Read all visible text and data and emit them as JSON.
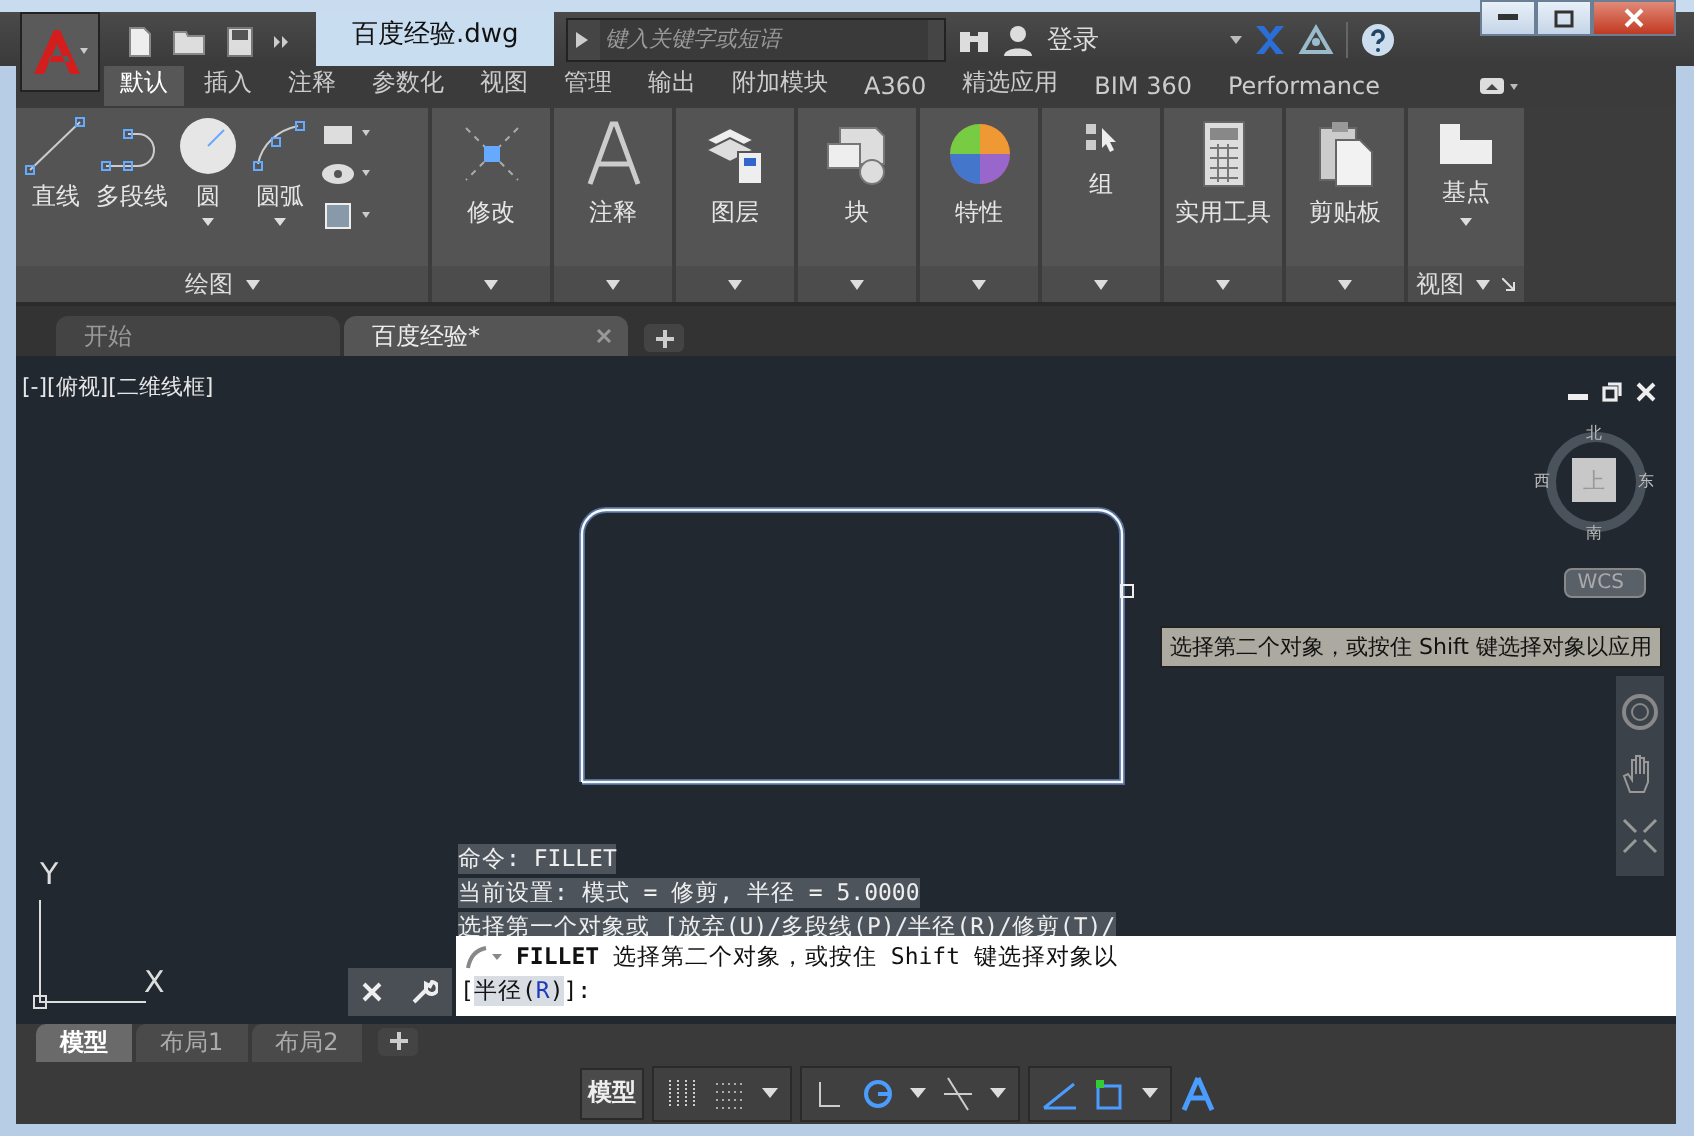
{
  "title_bar": {
    "title": "百度经验.dwg",
    "search": {
      "placeholder": "键入关键字或短语"
    },
    "sign_in": "登录"
  },
  "ribbon_tabs": [
    {
      "label": "默认",
      "selected": true
    },
    {
      "label": "插入",
      "selected": false
    },
    {
      "label": "注释",
      "selected": false
    },
    {
      "label": "参数化",
      "selected": false
    },
    {
      "label": "视图",
      "selected": false
    },
    {
      "label": "管理",
      "selected": false
    },
    {
      "label": "输出",
      "selected": false
    },
    {
      "label": "附加模块",
      "selected": false
    },
    {
      "label": "A360",
      "selected": false
    },
    {
      "label": "精选应用",
      "selected": false
    },
    {
      "label": "BIM 360",
      "selected": false
    },
    {
      "label": "Performance",
      "selected": false
    }
  ],
  "ribbon_panels": [
    {
      "kind": "draw",
      "tools": [
        "直线",
        "多段线",
        "圆",
        "圆弧"
      ],
      "footer": "绘图"
    },
    {
      "kind": "tool",
      "label": "修改"
    },
    {
      "kind": "tool",
      "label": "注释"
    },
    {
      "kind": "tool",
      "label": "图层"
    },
    {
      "kind": "tool",
      "label": "块"
    },
    {
      "kind": "tool",
      "label": "特性"
    },
    {
      "kind": "tool",
      "label": "组"
    },
    {
      "kind": "tool",
      "label": "实用工具"
    },
    {
      "kind": "tool",
      "label": "剪贴板"
    },
    {
      "kind": "view",
      "label": "基点",
      "footer": "视图"
    }
  ],
  "file_tabs": [
    {
      "label": "开始",
      "selected": false
    },
    {
      "label": "百度经验*",
      "selected": true
    }
  ],
  "viewport": {
    "label": "[-][俯视][二维线框]",
    "viewcube": {
      "north": "北",
      "south": "南",
      "east": "东",
      "west": "西",
      "face": "上",
      "ucs": "WCS"
    },
    "tooltip": "选择第二个对象，或按住 Shift 键选择对象以应用",
    "axis_y": "Y",
    "axis_x": "X"
  },
  "command_history": [
    "命令:  FILLET",
    "当前设置: 模式 = 修剪, 半径 = 5.0000",
    "选择第一个对象或 [放弃(U)/多段线(P)/半径(R)/修剪(T)/"
  ],
  "command_line": {
    "prompt_command": "FILLET",
    "prompt": "选择第二个对象，或按住 Shift 键选择对象以",
    "option_line": {
      "before": "[",
      "label": "半径",
      "open": "(",
      "key": "R",
      "close": ")",
      "after": "]:"
    }
  },
  "layout_tabs": [
    {
      "label": "模型",
      "selected": true
    },
    {
      "label": "布局1",
      "selected": false
    },
    {
      "label": "布局2",
      "selected": false
    }
  ],
  "status_bar": {
    "model_button": "模型"
  }
}
